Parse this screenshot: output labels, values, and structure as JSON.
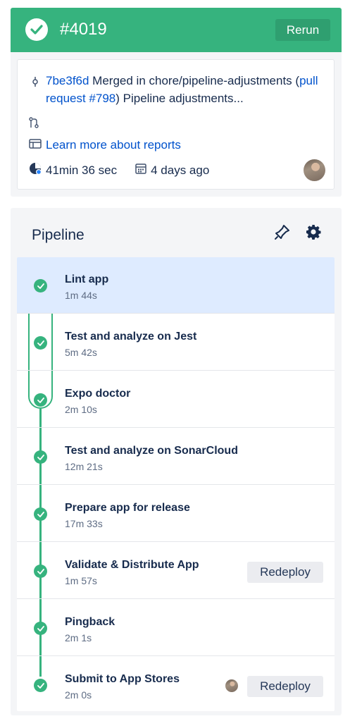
{
  "header": {
    "build_number": "#4019",
    "rerun_label": "Rerun",
    "status_color": "#36b37e"
  },
  "summary": {
    "commit_hash": "7be3f6d",
    "commit_message_pre": " Merged in chore/pipeline-adjustments (",
    "pr_link": "pull request #798",
    "commit_message_post": ") Pipeline adjustments...",
    "reports_link": "Learn more about reports",
    "duration": "41min 36 sec",
    "date": "4 days ago"
  },
  "pipeline": {
    "title": "Pipeline",
    "steps": [
      {
        "name": "Lint app",
        "duration": "1m 44s",
        "status": "success"
      },
      {
        "name": "Test and analyze on Jest",
        "duration": "5m 42s",
        "status": "success"
      },
      {
        "name": "Expo doctor",
        "duration": "2m 10s",
        "status": "success"
      },
      {
        "name": "Test and analyze on SonarCloud",
        "duration": "12m 21s",
        "status": "success"
      },
      {
        "name": "Prepare app for release",
        "duration": "17m 33s",
        "status": "success"
      },
      {
        "name": "Validate & Distribute App",
        "duration": "1m 57s",
        "status": "success",
        "action": "Redeploy"
      },
      {
        "name": "Pingback",
        "duration": "2m 1s",
        "status": "success"
      },
      {
        "name": "Submit to App Stores",
        "duration": "2m 0s",
        "status": "success",
        "action": "Redeploy"
      }
    ]
  },
  "colors": {
    "success": "#36b37e",
    "link": "#0052cc",
    "selected_row": "#deebff"
  },
  "icons": [
    "check-icon",
    "commit-icon",
    "pull-request-icon",
    "report-icon",
    "clock-icon",
    "calendar-icon",
    "pin-icon",
    "gear-icon"
  ]
}
